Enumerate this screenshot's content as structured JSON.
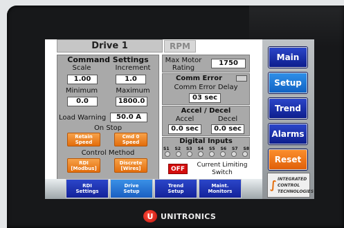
{
  "screen": {
    "title": "Drive 1",
    "rpm_label": "RPM"
  },
  "command_settings": {
    "heading": "Command Settings",
    "scale_label": "Scale",
    "increment_label": "Increment",
    "scale_value": "1.00",
    "increment_value": "1.0",
    "minimum_label": "Minimum",
    "maximum_label": "Maximum",
    "minimum_value": "0.0",
    "maximum_value": "1800.0",
    "load_warning_label": "Load Warning",
    "load_warning_value": "50.0 A",
    "on_stop_label": "On Stop",
    "retain_speed": "Retain\nSpeed",
    "cmd0_speed": "Cmd 0\nSpeed",
    "control_method_label": "Control Method",
    "rdi_modbus": "RDI\n[Modbus]",
    "discrete_wires": "Discrete\n[Wires]"
  },
  "motor": {
    "max_rating_label": "Max Motor\nRating",
    "max_rating_value": "1750"
  },
  "comm_error": {
    "heading": "Comm Error",
    "delay_label": "Comm Error Delay",
    "delay_value": "03 sec"
  },
  "accel_decel": {
    "heading": "Accel / Decel",
    "accel_label": "Accel",
    "decel_label": "Decel",
    "accel_value": "0.0 sec",
    "decel_value": "0.0 sec"
  },
  "digital_inputs": {
    "heading": "Digital Inputs",
    "labels": [
      "S1",
      "S2",
      "S3",
      "S4",
      "S5",
      "S6",
      "S7",
      "S8"
    ]
  },
  "current_limiting": {
    "state": "OFF",
    "label": "Current Limiting\nSwitch"
  },
  "nav": {
    "main": "Main",
    "setup": "Setup",
    "trend": "Trend",
    "alarms": "Alarms",
    "reset": "Reset"
  },
  "tabs": {
    "rdi_settings": "RDI\nSettings",
    "drive_setup": "Drive\nSetup",
    "trend_setup": "Trend\nSetup",
    "maint_monitors": "Maint.\nMonitors"
  },
  "company_logo": {
    "line1": "Integrated",
    "line2": "Control",
    "line3": "Technologies"
  },
  "device_brand": "UNITRONICS",
  "device_brand_mark": "U",
  "colors": {
    "nav_blue": "#0d1e8d",
    "active_blue": "#1163c4",
    "orange": "#e36d0b",
    "off_red": "#d40d0d"
  }
}
